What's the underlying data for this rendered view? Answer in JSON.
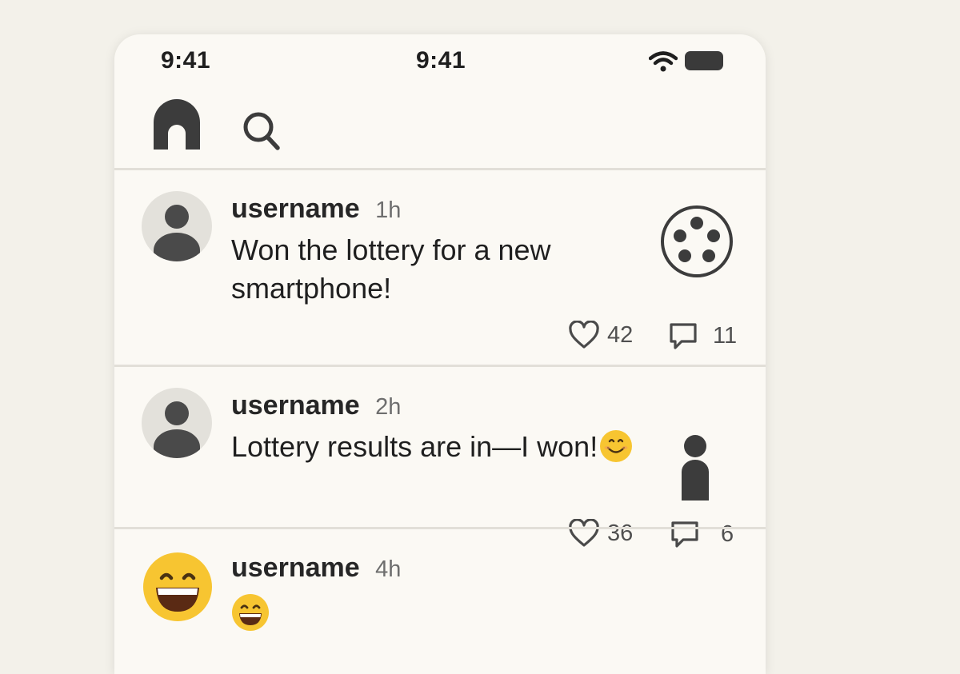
{
  "status_bar": {
    "time_left": "9:41",
    "time_center": "9:41",
    "icons": [
      "wifi-icon",
      "battery-icon"
    ]
  },
  "nav": {
    "icons": [
      "home-icon",
      "search-icon"
    ]
  },
  "posts": [
    {
      "username": "username",
      "time": "1h",
      "text": "Won the lottery for a new smartphone!",
      "avatar": "person-avatar",
      "media": "lottery-ball-icon",
      "likes": "42",
      "comments": "11"
    },
    {
      "username": "username",
      "time": "2h",
      "text": "Lottery results are in—I won!",
      "text_emoji": "smiling-face-emoji",
      "avatar": "person-avatar",
      "media": "person-icon",
      "likes": "36",
      "comments": "6"
    },
    {
      "username": "username",
      "time": "4h",
      "text_emoji": "grinning-face-emoji",
      "avatar": "grinning-face-emoji"
    }
  ],
  "colors": {
    "background": "#f3f1ea",
    "card": "#fbf9f4",
    "icon_dark": "#3c3c3c",
    "divider": "#e2dfd8",
    "emoji_yellow": "#f7c531"
  }
}
